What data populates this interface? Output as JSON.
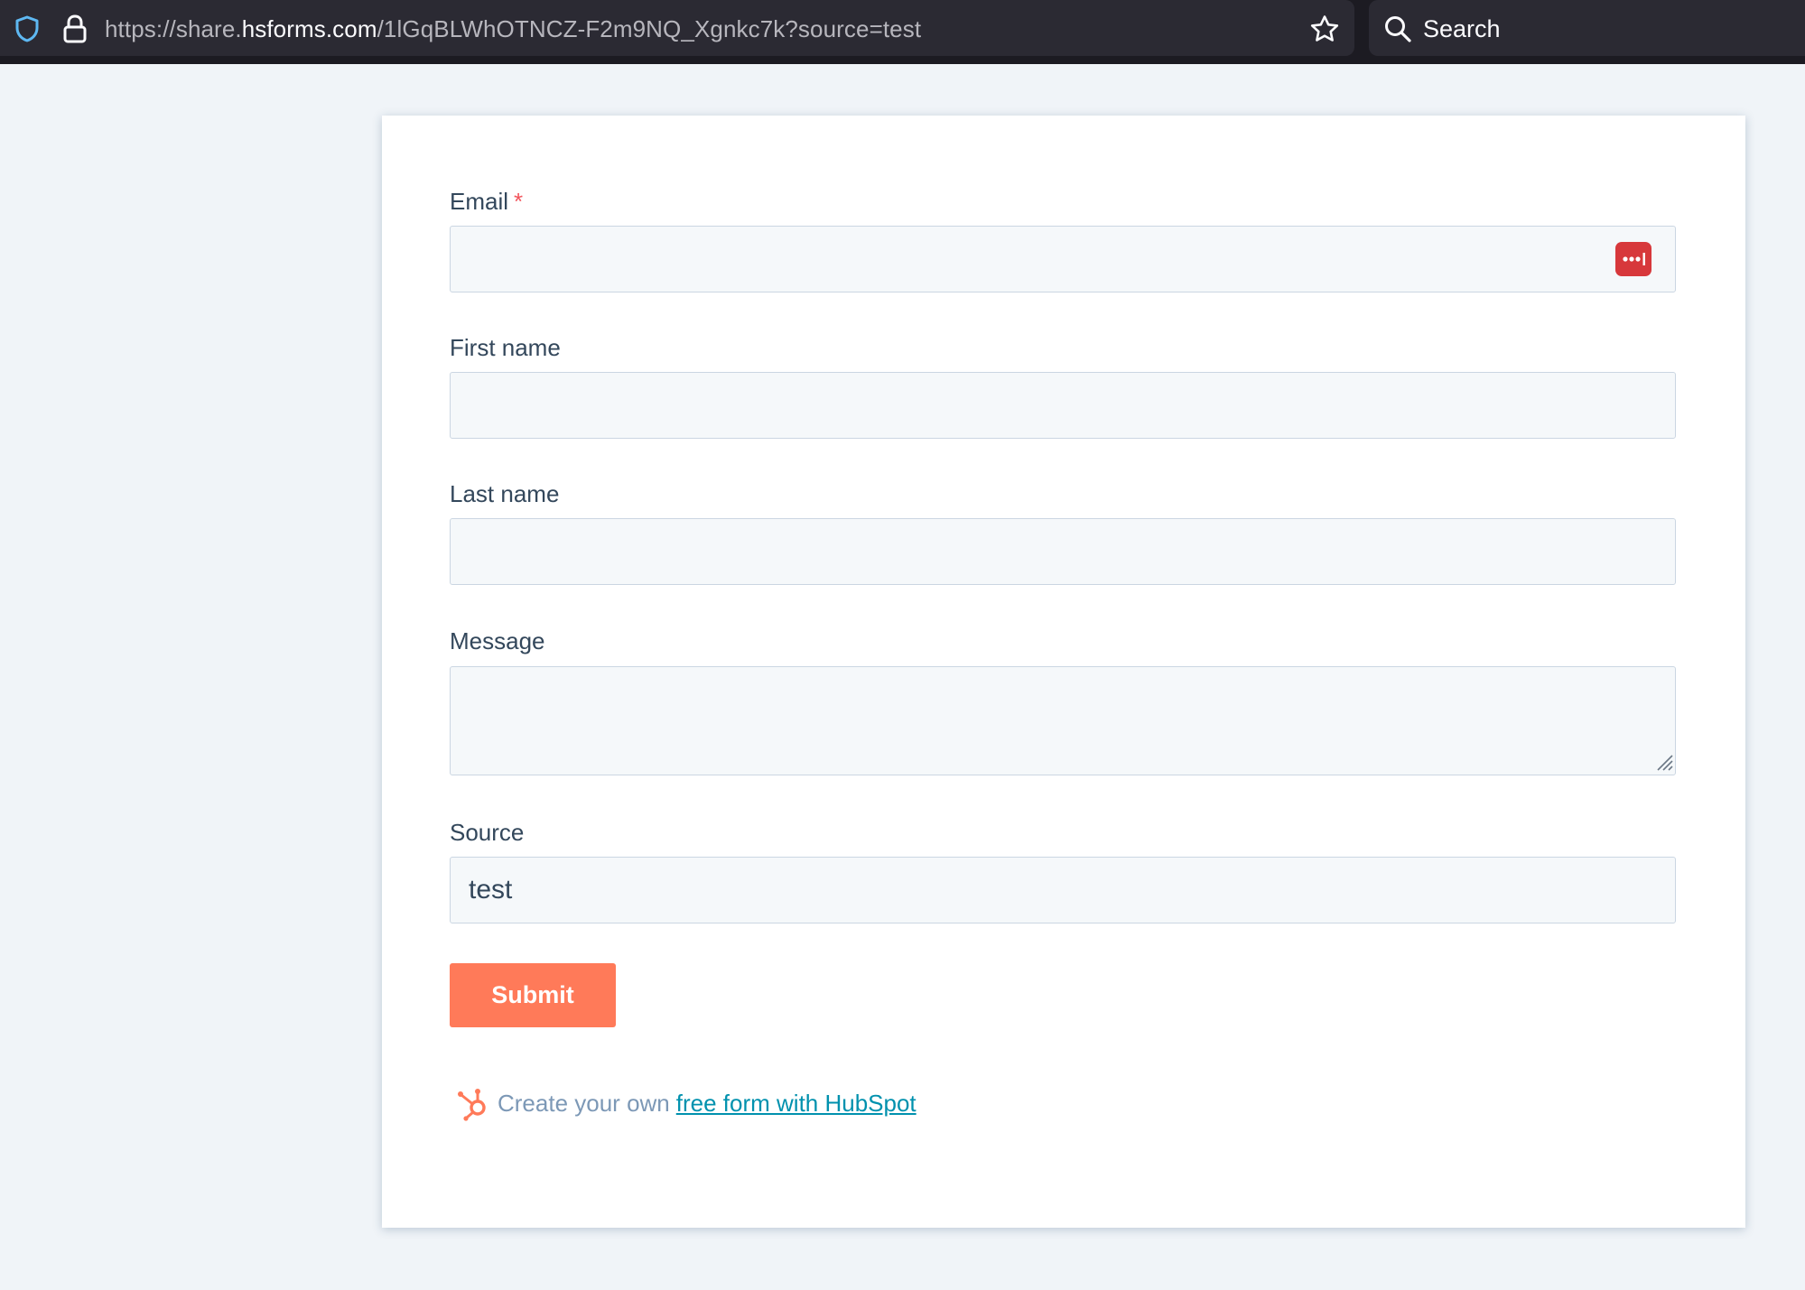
{
  "browser": {
    "url_prefix": "https://share.",
    "url_domain": "hsforms.com",
    "url_path": "/1lGqBLWhOTNCZ-F2m9NQ_Xgnkc7k?source=test",
    "search_label": "Search"
  },
  "form": {
    "email": {
      "label": "Email",
      "required_mark": "*",
      "value": ""
    },
    "first_name": {
      "label": "First name",
      "value": ""
    },
    "last_name": {
      "label": "Last name",
      "value": ""
    },
    "message": {
      "label": "Message",
      "value": ""
    },
    "source": {
      "label": "Source",
      "value": "test"
    },
    "submit_label": "Submit"
  },
  "footer": {
    "text": "Create your own",
    "link_text": "free form with HubSpot"
  },
  "colors": {
    "accent": "#ff7a59",
    "link": "#0091ae",
    "required": "#f2545b",
    "password_manager": "#d7383b"
  },
  "icons": {
    "tracking": "shield-icon",
    "security": "lock-icon",
    "bookmark": "star-icon",
    "search": "search-icon",
    "password_manager": "password-manager-icon",
    "brand": "hubspot-logo-icon"
  }
}
